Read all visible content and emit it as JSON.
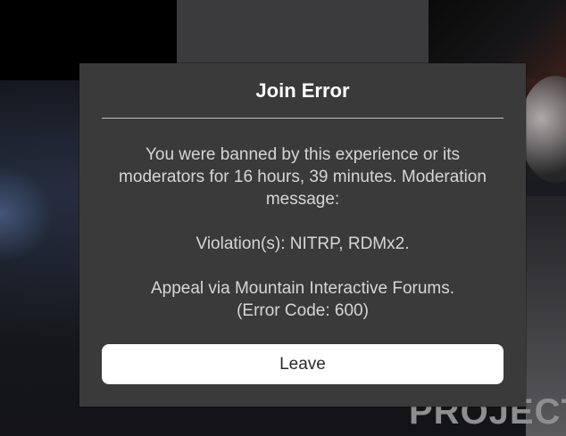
{
  "background": {
    "brand_text": "PROJECT"
  },
  "dialog": {
    "title": "Join Error",
    "message": {
      "ban_notice": "You were banned by this experience or its moderators for 16 hours, 39 minutes. Moderation message:",
      "violations": "Violation(s): NITRP, RDMx2.",
      "appeal": "Appeal via Mountain Interactive Forums.",
      "error_code": "(Error Code: 600)"
    },
    "leave_button_label": "Leave"
  },
  "colors": {
    "dialog_background": "#3a3a3b",
    "title_text": "#ffffff",
    "body_text": "#d6d6d6",
    "button_background": "#ffffff",
    "button_text": "#2b2b2b"
  }
}
